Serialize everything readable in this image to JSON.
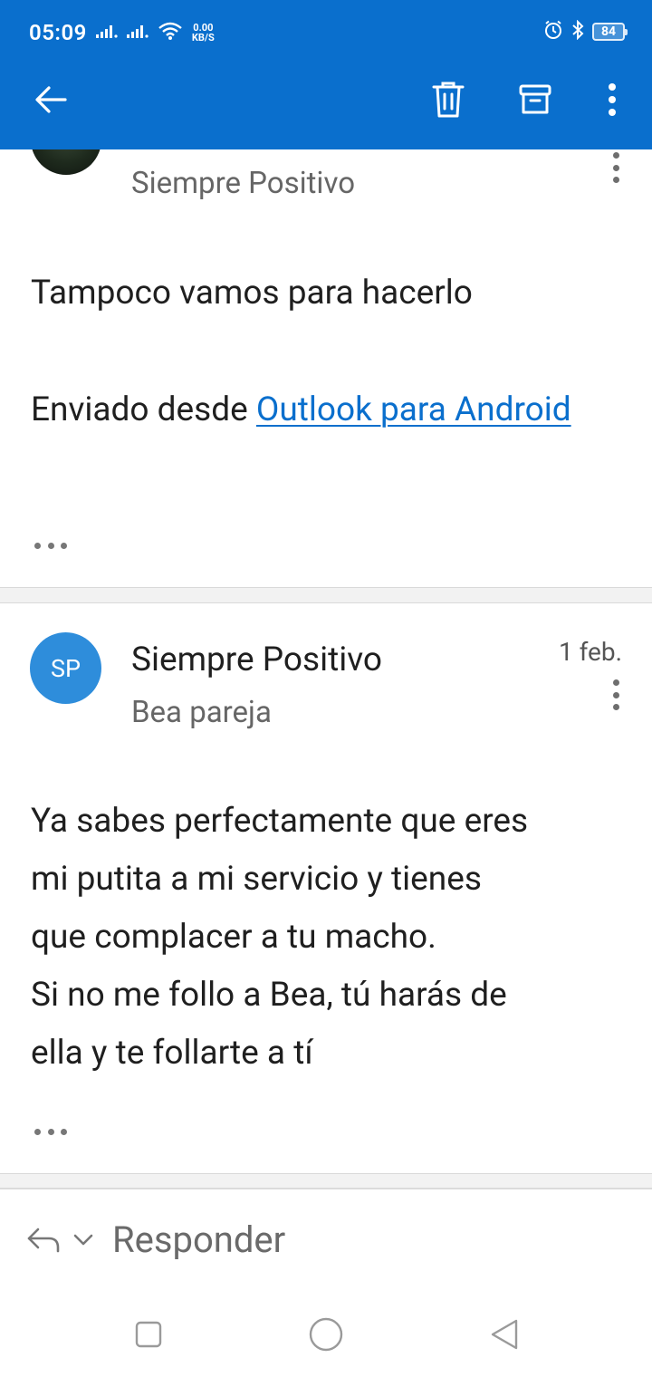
{
  "status_bar": {
    "time": "05:09",
    "net_speed_value": "0.00",
    "net_speed_unit": "KB/S",
    "battery": "84"
  },
  "toolbar": {
    "back": "arrow-back-icon",
    "delete": "trash-icon",
    "archive": "archive-icon",
    "more": "more-vert-icon"
  },
  "messages": [
    {
      "recipient": "Siempre Positivo",
      "body_line1": "Tampoco vamos para hacerlo",
      "signature_prefix": "Enviado desde ",
      "signature_link": "Outlook para Android"
    },
    {
      "avatar_initials": "SP",
      "sender": "Siempre Positivo",
      "recipient": "Bea pareja",
      "date": "1 feb.",
      "body_lines": [
        "Ya sabes perfectamente que eres",
        "mi putita a mi servicio y tienes",
        "que complacer a tu macho.",
        "Si no me follo a Bea, tú harás de",
        "ella y te follarte a tí"
      ]
    }
  ],
  "reply": {
    "label": "Responder"
  },
  "colors": {
    "accent": "#0a6fcd",
    "avatar_bg": "#2e8ddb"
  }
}
